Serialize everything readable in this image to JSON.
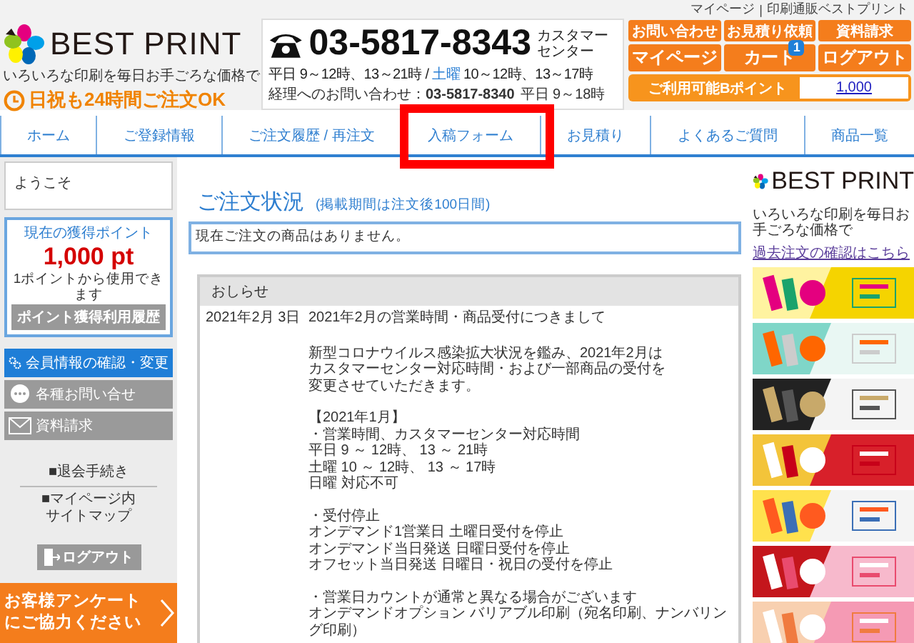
{
  "top_bar": {
    "links": [
      "マイページ",
      "印刷通販ベストプリント"
    ],
    "separator": "|"
  },
  "logo": {
    "name": "BEST PRINT",
    "tagline": "いろいろな印刷を毎日お手ごろな価格で",
    "badge": "日祝も24時間ご注文OK"
  },
  "contact": {
    "phone": "03-5817-8343",
    "phone_label": "カスタマーセンター",
    "hours": {
      "before": "平日 9～12時、13～21時 / ",
      "highlight": "土曜",
      "after": " 10～12時、13～17時"
    },
    "accounting": "経理へのお問い合わせ：**03-5817-8340**",
    "accounting_hours": "平日 9～18時"
  },
  "header_buttons": [
    {
      "label": "お問い合わせ",
      "kind": "small"
    },
    {
      "label": "お見積り依頼",
      "kind": "small"
    },
    {
      "label": "資料請求",
      "kind": "small"
    },
    {
      "label": "マイページ",
      "kind": "large"
    },
    {
      "label": "カート",
      "kind": "large",
      "badge": "1"
    },
    {
      "label": "ログアウト",
      "kind": "large"
    }
  ],
  "points_bar": {
    "label": "ご利用可能Bポイント",
    "value": "1,000"
  },
  "tabs": [
    {
      "label": "ホーム",
      "highlighted": false
    },
    {
      "label": "ご登録情報",
      "highlighted": false
    },
    {
      "label": "ご注文履歴 / 再注文",
      "highlighted": false
    },
    {
      "label": "入稿フォーム",
      "highlighted": true
    },
    {
      "label": "お見積り",
      "highlighted": false
    },
    {
      "label": "よくあるご質問",
      "highlighted": false
    },
    {
      "label": "商品一覧",
      "highlighted": false
    }
  ],
  "sidebar": {
    "welcome": "ようこそ",
    "points": {
      "title": "現在の獲得ポイント",
      "value": "1,000 pt",
      "note": "1ポイントから使用できます",
      "button": "ポイント獲得利用履歴"
    },
    "menu": [
      {
        "label": "会員情報の確認・変更",
        "kind": "gears",
        "selected": true
      },
      {
        "label": "各種お問い合せ",
        "kind": "chat",
        "selected": false
      },
      {
        "label": "資料請求",
        "kind": "mail",
        "selected": false
      }
    ],
    "links": [
      "■退会手続き",
      "■マイページ内サイトマップ"
    ],
    "logout": "ログアウト",
    "survey": "お客様アンケートにご協力ください"
  },
  "order_status": {
    "title": "ご注文状況",
    "subtitle": "(掲載期間は注文後100日間)",
    "message": "現在ご注文の商品はありません。"
  },
  "notices": {
    "title": "おしらせ",
    "items": [
      {
        "date": "2021年2月 3日",
        "title": "2021年2月の営業時間・商品受付につきまして",
        "body": [
          [
            "新型コロナウイルス感染拡大状況を鑑み、2021年2月は",
            "カスタマーセンター対応時間・および一部商品の受付を",
            "変更させていただきます。"
          ],
          [
            "【2021年1月】",
            "・営業時間、カスタマーセンター対応時間",
            "平日 9 ～ 12時、 13 ～ 21時",
            "土曜 10 ～ 12時、 13 ～ 17時",
            "日曜 対応不可"
          ],
          [
            "・受付停止",
            "オンデマンド1営業日 土曜日受付を停止",
            "オンデマンド当日発送 日曜日受付を停止",
            "オフセット当日発送 日曜日・祝日の受付を停止"
          ],
          [
            "・営業日カウントが通常と異なる場合がございます",
            "オンデマンドオプション バリアブル印刷（宛名印刷、ナンバリング印刷）"
          ]
        ]
      }
    ]
  },
  "right_column": {
    "logo_name": "BEST PRINT",
    "logo_tagline": "いろいろな印刷を毎日お手ごろな価格で",
    "link": "過去注文の確認はこちら"
  }
}
